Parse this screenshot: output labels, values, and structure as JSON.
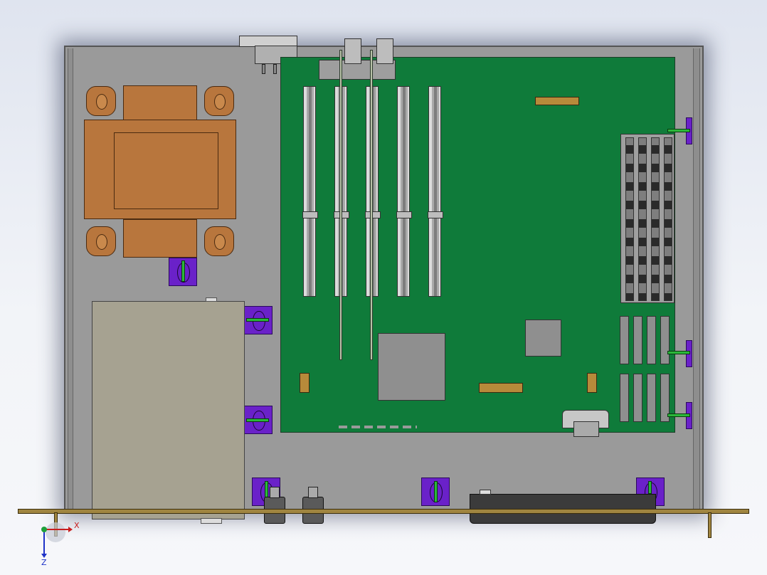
{
  "view": {
    "background_color": "#e6e9f1",
    "board_color": "#0f7b3a",
    "transformer_color": "#b8763d",
    "standoff_color": "#6a21c9"
  },
  "triad": {
    "x_label": "X",
    "z_label": "Z"
  }
}
